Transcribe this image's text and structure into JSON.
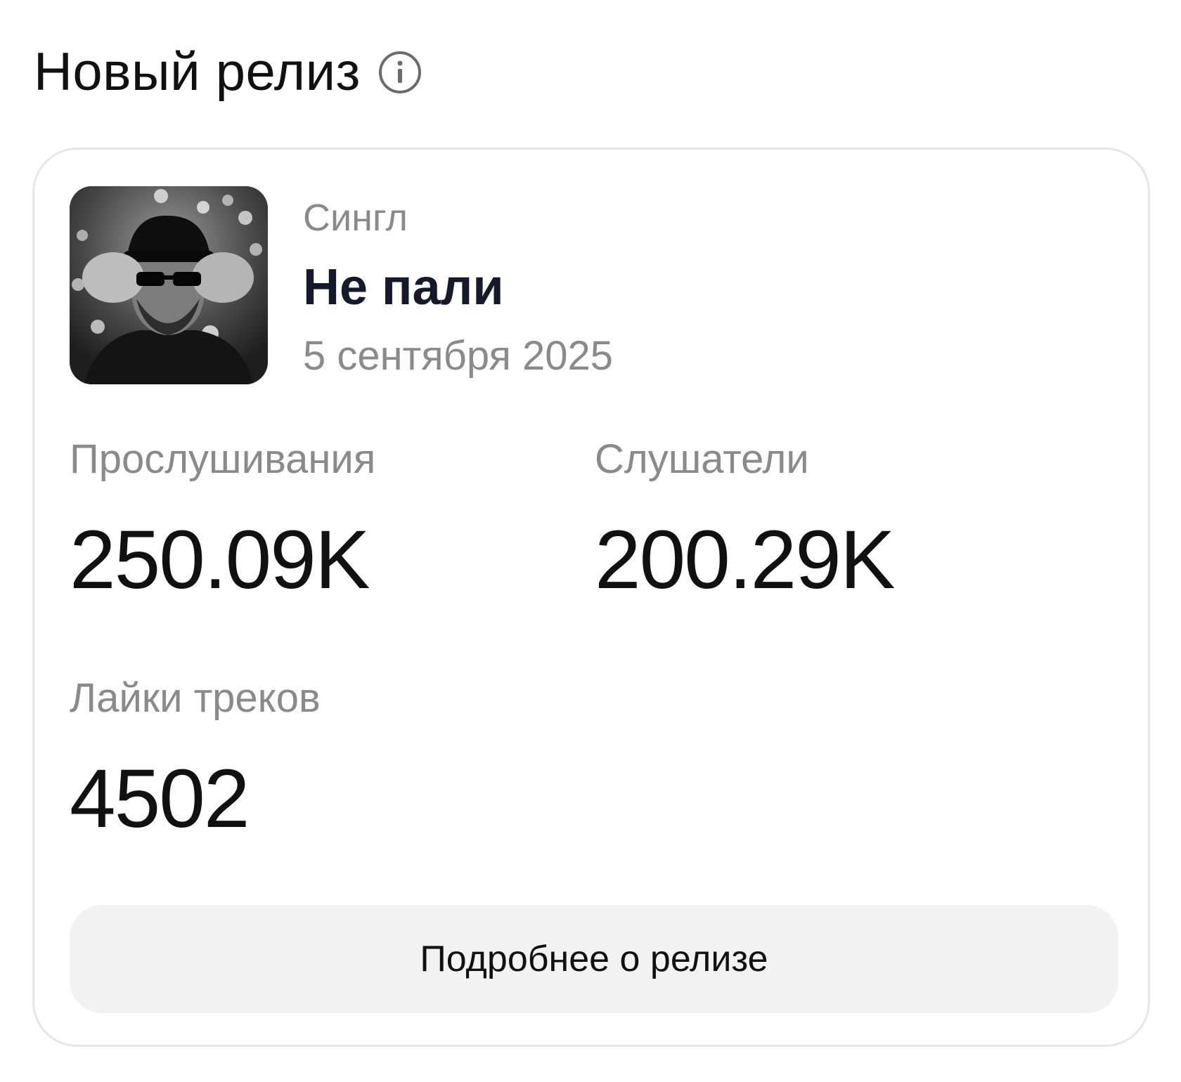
{
  "header": {
    "title": "Новый релиз",
    "info_icon": "info-circle-icon"
  },
  "release": {
    "cover_image": "album-cover",
    "type": "Сингл",
    "title": "Не пали",
    "date": "5 сентября 2025"
  },
  "stats": {
    "streams": {
      "label": "Прослушивания",
      "value": "250.09K"
    },
    "listeners": {
      "label": "Слушатели",
      "value": "200.29K"
    },
    "likes": {
      "label": "Лайки треков",
      "value": "4502"
    }
  },
  "actions": {
    "details_label": "Подробнее о релизе"
  },
  "colors": {
    "text_primary": "#111111",
    "text_secondary": "#8a8a8a",
    "title_color": "#141a2a",
    "card_border": "#e6e6e6",
    "button_bg": "#f2f2f2"
  }
}
